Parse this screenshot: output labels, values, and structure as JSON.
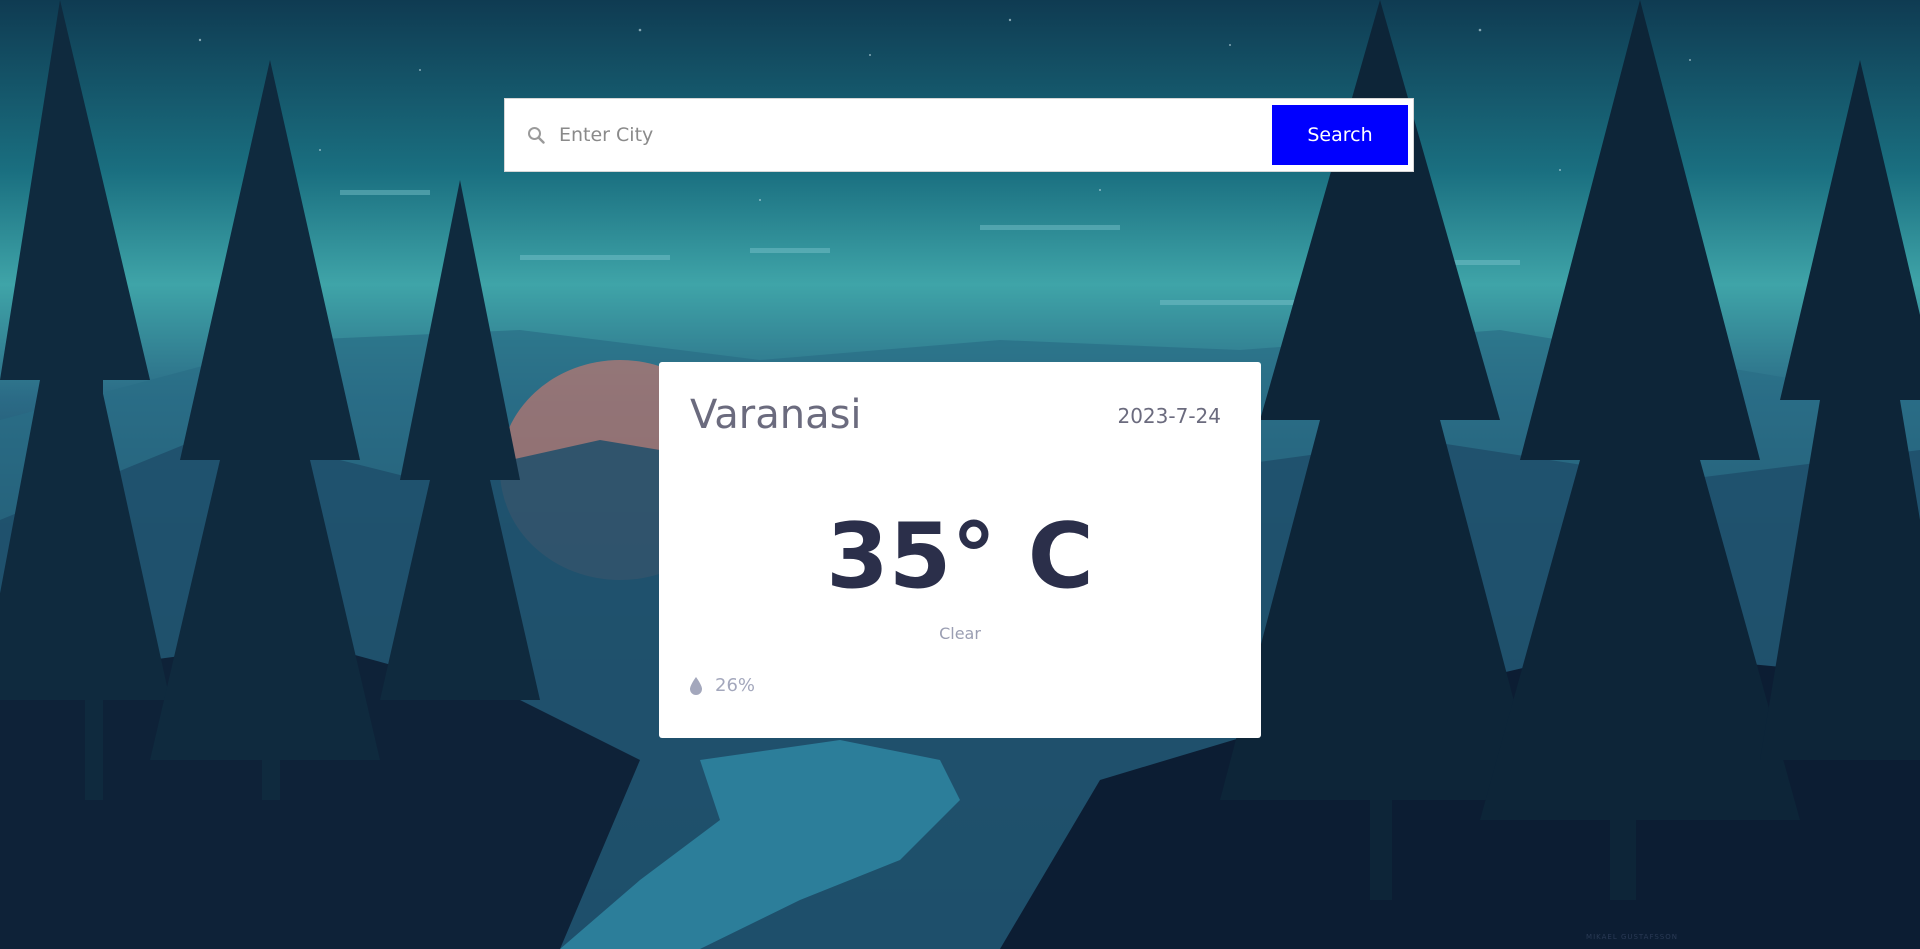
{
  "search": {
    "placeholder": "Enter City",
    "value": "",
    "button_label": "Search",
    "button_color": "#0000ff"
  },
  "weather": {
    "city": "Varanasi",
    "date": "2023-7-24",
    "temperature": "35° C",
    "condition": "Clear",
    "humidity": "26%",
    "humidity_icon": "water-drop-icon"
  },
  "background": {
    "credit": "MIKAEL GUSTAFSSON"
  }
}
